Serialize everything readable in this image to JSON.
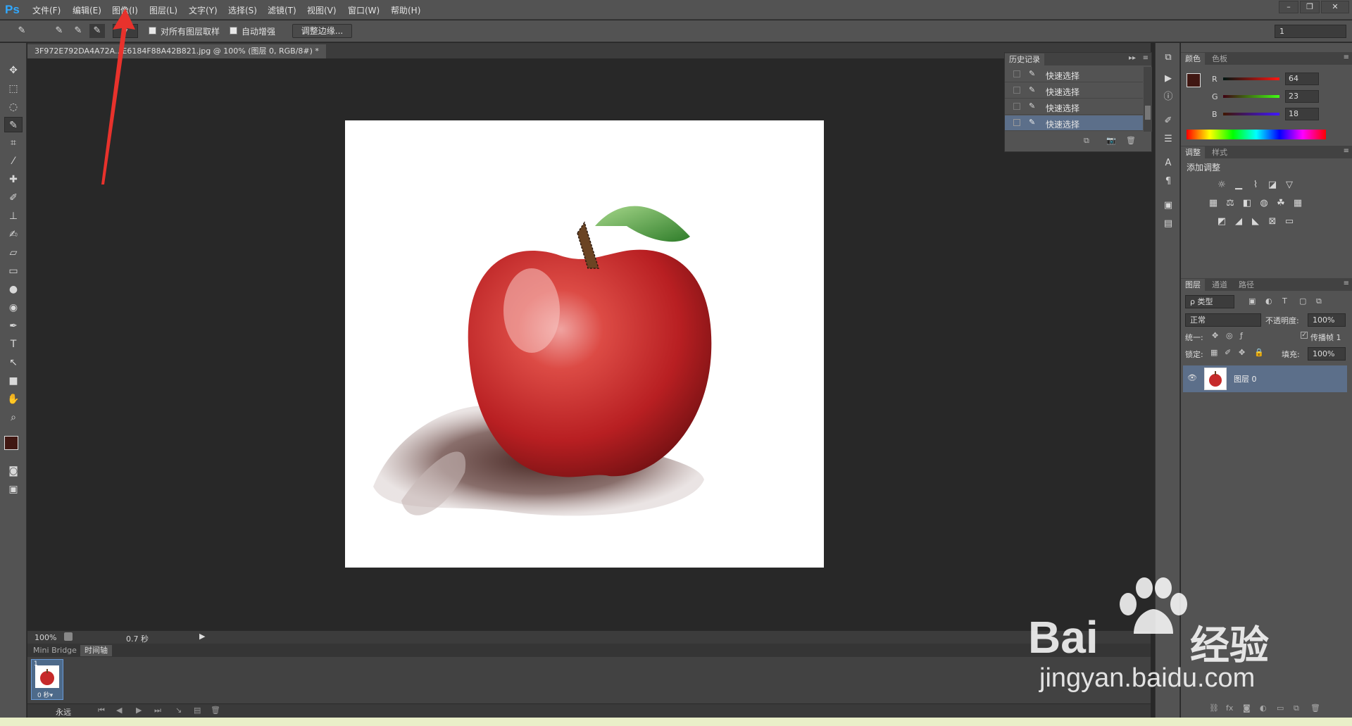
{
  "app": {
    "logo": "Ps"
  },
  "menu": [
    "文件(F)",
    "编辑(E)",
    "图像(I)",
    "图层(L)",
    "文字(Y)",
    "选择(S)",
    "滤镜(T)",
    "视图(V)",
    "窗口(W)",
    "帮助(H)"
  ],
  "window_controls": [
    "–",
    "❐",
    "✕"
  ],
  "options": {
    "sample_all_layers": "对所有图层取样",
    "auto_enhance": "自动增强",
    "refine_edge": "调整边缘...",
    "right_value": "1"
  },
  "document": {
    "tab_title": "3F972E792DA4A72A...E6184F88A42B821.jpg @ 100% (图层 0, RGB/8#) *",
    "close": "×"
  },
  "status": {
    "zoom": "100%",
    "time": "0.7 秒"
  },
  "bottom_tabs": [
    "Mini Bridge",
    "时间轴"
  ],
  "timeline": {
    "frame_number": "1",
    "frame_delay": "0 秒▾",
    "loop": "永远"
  },
  "history": {
    "tab": "历史记录",
    "items": [
      "快速选择",
      "快速选择",
      "快速选择",
      "快速选择"
    ]
  },
  "color_panel": {
    "tabs": [
      "颜色",
      "色板"
    ],
    "r_label": "R",
    "r": "64",
    "g_label": "G",
    "g": "23",
    "b_label": "B",
    "b": "18",
    "foreground": "#401712"
  },
  "adjust_panel": {
    "tabs": [
      "调整",
      "样式"
    ],
    "title": "添加调整"
  },
  "layers_panel": {
    "tabs": [
      "图层",
      "通道",
      "路径"
    ],
    "kind": "ρ 类型",
    "blend": "正常",
    "opacity_label": "不透明度:",
    "opacity": "100%",
    "unify_label": "统一:",
    "propagate": "传播帧 1",
    "lock_label": "锁定:",
    "fill_label": "填充:",
    "fill": "100%",
    "layer_name": "图层 0"
  },
  "watermark": {
    "brand": "Bai",
    "brand2": "经验",
    "url": "jingyan.baidu.com"
  },
  "colors": {
    "accent_blue": "#31a8ff",
    "annotation_red": "#e8322c"
  }
}
